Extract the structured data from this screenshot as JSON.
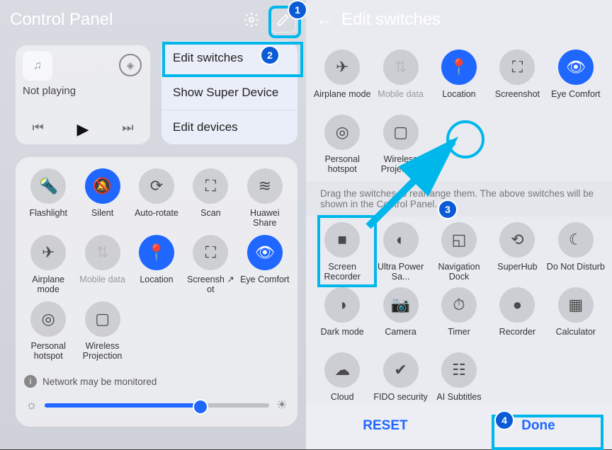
{
  "left": {
    "title": "Control Panel",
    "music": {
      "status": "Not playing"
    },
    "menu": [
      "Edit switches",
      "Show Super Device",
      "Edit devices"
    ],
    "switches_row1": [
      {
        "label": "Flashlight",
        "icon": "flash",
        "on": false
      },
      {
        "label": "Silent",
        "icon": "bell",
        "on": true
      },
      {
        "label": "Auto-rotate",
        "icon": "rotate",
        "on": false
      },
      {
        "label": "Scan",
        "icon": "scan",
        "on": false
      },
      {
        "label": "Huawei Share",
        "icon": "share",
        "on": false
      }
    ],
    "switches_row2": [
      {
        "label": "Airplane mode",
        "icon": "plane",
        "on": false
      },
      {
        "label": "Mobile data",
        "icon": "data",
        "on": false,
        "dim": true
      },
      {
        "label": "Location",
        "icon": "pin",
        "on": true
      },
      {
        "label": "Screensh ↗ ot",
        "icon": "shot",
        "on": false
      },
      {
        "label": "Eye Comfort",
        "icon": "eye",
        "on": true
      }
    ],
    "switches_row3": [
      {
        "label": "Personal hotspot",
        "icon": "hotspot",
        "on": false
      },
      {
        "label": "Wireless Projection",
        "icon": "cast",
        "on": false
      }
    ],
    "note": "Network may be monitored"
  },
  "right": {
    "title": "Edit switches",
    "top": [
      {
        "label": "Airplane mode",
        "icon": "plane",
        "on": false
      },
      {
        "label": "Mobile data",
        "icon": "data",
        "on": false,
        "dim": true
      },
      {
        "label": "Location",
        "icon": "pin",
        "on": true
      },
      {
        "label": "Screenshot",
        "icon": "shot",
        "on": false
      },
      {
        "label": "Eye Comfort",
        "icon": "eye",
        "on": true
      },
      {
        "label": "Personal hotspot",
        "icon": "hotspot",
        "on": false
      },
      {
        "label": "Wireless Projection",
        "icon": "cast",
        "on": false
      }
    ],
    "dragText": "Drag the switches to rearrange them. The above switches will be shown in the Control Panel.",
    "bottom": [
      {
        "label": "Screen Recorder",
        "icon": "rec"
      },
      {
        "label": "Ultra Power Sa...",
        "icon": "power"
      },
      {
        "label": "Navigation Dock",
        "icon": "nav"
      },
      {
        "label": "SuperHub",
        "icon": "hub"
      },
      {
        "label": "Do Not Disturb",
        "icon": "moon"
      },
      {
        "label": "Dark mode",
        "icon": "dark"
      },
      {
        "label": "Camera",
        "icon": "cam"
      },
      {
        "label": "Timer",
        "icon": "timer"
      },
      {
        "label": "Recorder",
        "icon": "mic"
      },
      {
        "label": "Calculator",
        "icon": "calc"
      },
      {
        "label": "Cloud",
        "icon": "cloud"
      },
      {
        "label": "FIDO security ...",
        "icon": "fido"
      },
      {
        "label": "AI Subtitles",
        "icon": "subs"
      }
    ],
    "reset": "RESET",
    "done": "Done"
  },
  "icons": {
    "flash": "🔦",
    "bell": "🔕",
    "rotate": "⟳",
    "scan": "⛶",
    "share": "≋",
    "plane": "✈",
    "data": "⇅",
    "pin": "📍",
    "shot": "⛶",
    "eye": "👁",
    "hotspot": "◎",
    "cast": "▢",
    "rec": "■",
    "power": "◐",
    "nav": "◱",
    "hub": "⟲",
    "moon": "☾",
    "dark": "◑",
    "cam": "📷",
    "timer": "⏱",
    "mic": "●",
    "calc": "▦",
    "cloud": "☁",
    "fido": "✔",
    "subs": "☷"
  },
  "annotations": {
    "1": "1",
    "2": "2",
    "3": "3",
    "4": "4"
  }
}
